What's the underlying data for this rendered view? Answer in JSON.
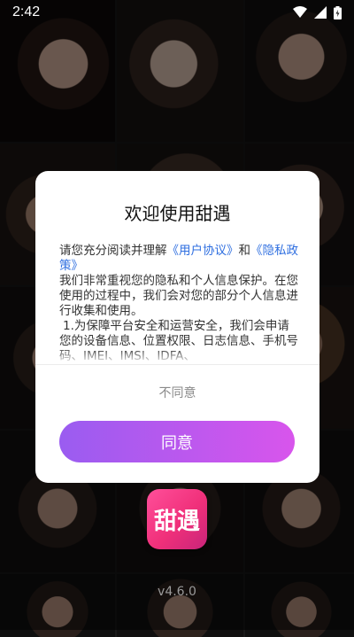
{
  "status_bar": {
    "time": "2:42",
    "icons": [
      "wifi-icon",
      "signal-icon",
      "battery-icon"
    ]
  },
  "dialog": {
    "title": "欢迎使用甜遇",
    "body": {
      "intro": "请您充分阅读并理解",
      "user_agreement_link": "《用户协议》",
      "and": "和",
      "privacy_policy_link": "《隐私政策》",
      "paragraph2": "我们非常重视您的隐私和个人信息保护。在您使用的过程中，我们会对您的部分个人信息进行收集和使用。",
      "paragraph3": "1.为保障平台安全和运营安全，我们会申请您的设备信息、位置权限、日志信息、手机号码、IMEI、IMSI、IDFA、"
    },
    "disagree_label": "不同意",
    "agree_label": "同意"
  },
  "app": {
    "icon_text": "甜遇",
    "version": "v4.6.0"
  },
  "colors": {
    "agree_gradient_start": "#9a5cf0",
    "agree_gradient_end": "#d855ec",
    "link": "#2f6fe0",
    "app_icon": "#f0307a"
  }
}
